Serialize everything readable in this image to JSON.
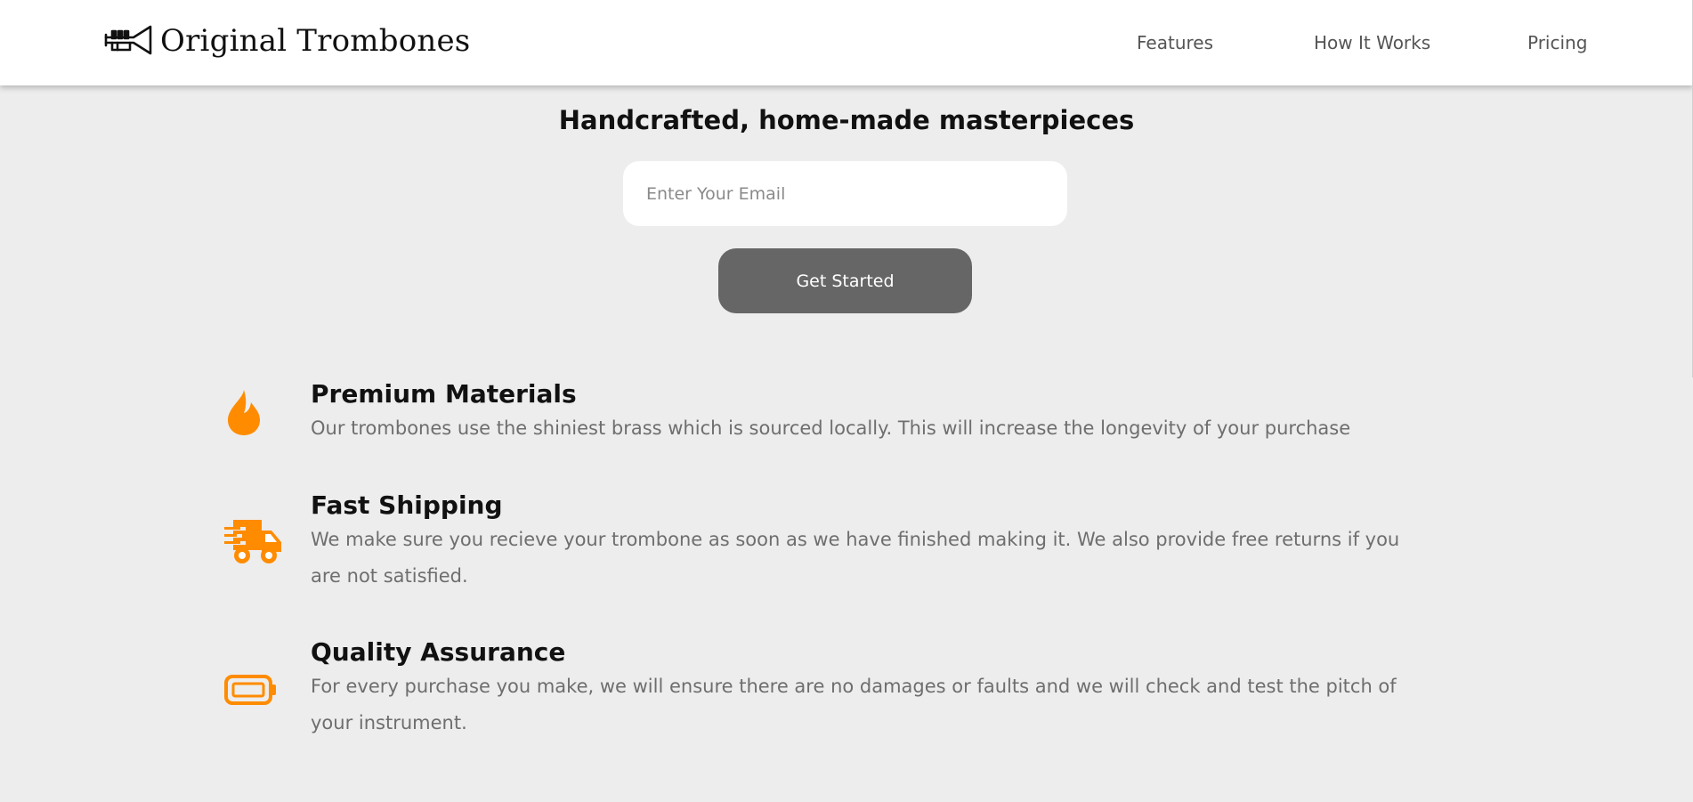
{
  "brand": {
    "name": "Original Trombones",
    "icon": "trombone-icon"
  },
  "nav": {
    "items": [
      {
        "label": "Features"
      },
      {
        "label": "How It Works"
      },
      {
        "label": "Pricing"
      }
    ]
  },
  "hero": {
    "title": "Handcrafted, home-made masterpieces",
    "email_placeholder": "Enter Your Email",
    "email_value": "",
    "cta_label": "Get Started"
  },
  "features": [
    {
      "icon": "fire-icon",
      "title": "Premium Materials",
      "description": "Our trombones use the shiniest brass which is sourced locally. This will increase the longevity of your purchase"
    },
    {
      "icon": "shipping-truck-icon",
      "title": "Fast Shipping",
      "description": "We make sure you recieve your trombone as soon as we have finished making it. We also provide free returns if you are not satisfied."
    },
    {
      "icon": "battery-full-icon",
      "title": "Quality Assurance",
      "description": "For every purchase you make, we will ensure there are no damages or faults and we will check and test the pitch of your instrument."
    }
  ],
  "colors": {
    "accent": "#ff8c00",
    "background": "#ededed",
    "header_bg": "#ffffff",
    "button_bg": "#666666"
  }
}
